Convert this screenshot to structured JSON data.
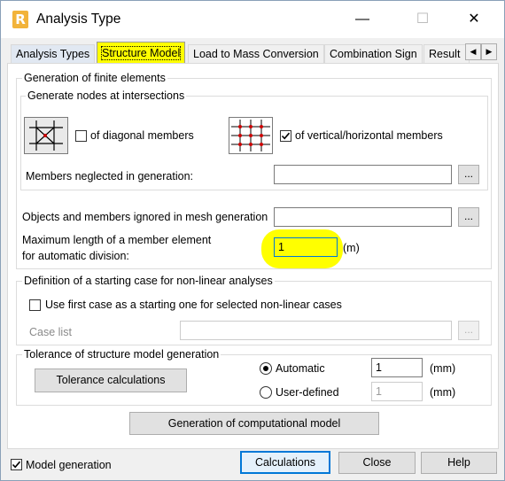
{
  "window": {
    "title": "Analysis Type",
    "app_icon_letter": "R",
    "minimize_glyph": "—",
    "maximize_glyph": "☐",
    "close_glyph": "✕"
  },
  "tabs": [
    {
      "label": "Analysis Types"
    },
    {
      "label": "Structure Model",
      "active": true
    },
    {
      "label": "Load to Mass Conversion"
    },
    {
      "label": "Combination Sign"
    },
    {
      "label": "Result"
    }
  ],
  "tab_scroll": {
    "left": "◀",
    "right": "▶"
  },
  "generation": {
    "title": "Generation of finite elements",
    "nodes_group_title": "Generate nodes at intersections",
    "diagonal_label": "of diagonal members",
    "diagonal_checked": false,
    "vertical_label": "of vertical/horizontal members",
    "vertical_checked": true,
    "neglected_label": "Members neglected in generation:",
    "neglected_value": "",
    "browse_label": "...",
    "ignored_label": "Objects and members ignored in mesh generation",
    "ignored_value": "",
    "maxlen_label_1": "Maximum length of a member element",
    "maxlen_label_2": "for automatic division:",
    "maxlen_value": "1",
    "maxlen_unit": "(m)"
  },
  "nonlinear": {
    "title": "Definition of a starting case for non-linear analyses",
    "use_first_label": "Use first case as a starting one for selected non-linear cases",
    "use_first_checked": false,
    "case_list_label": "Case list",
    "case_list_value": ""
  },
  "tolerance": {
    "title": "Tolerance of structure model generation",
    "calc_button": "Tolerance calculations",
    "automatic_label": "Automatic",
    "automatic_value": "1",
    "automatic_selected": true,
    "user_label": "User-defined",
    "user_value": "1",
    "unit": "(mm)"
  },
  "generate_button": "Generation of computational model",
  "footer": {
    "model_generation_label": "Model generation",
    "model_generation_checked": true,
    "calculations": "Calculations",
    "close": "Close",
    "help": "Help"
  },
  "colors": {
    "highlight": "#ffff00",
    "grid_red": "#cc0000",
    "focus_blue": "#0078d7"
  }
}
